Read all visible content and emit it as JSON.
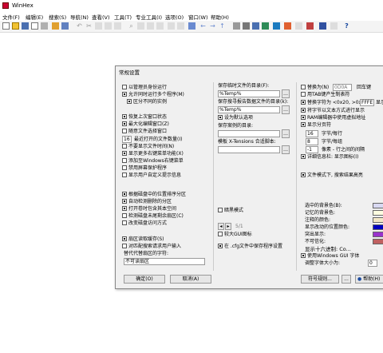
{
  "window": {
    "title": "WinHex"
  },
  "menu": [
    "文件(F)",
    "编辑(E)",
    "搜索(S)",
    "导航(N)",
    "查看(V)",
    "工具(T)",
    "专业工具(I)",
    "选项(O)",
    "窗口(W)",
    "帮助(H)"
  ],
  "dialog": {
    "title": "常规设置",
    "col1": {
      "run_as_admin": "以管理员身份运行",
      "allow_multi": "允许同时运行多个程序(M)",
      "no_sync": "区分不同的实例",
      "restore_last": "恢复上次窗口状态",
      "maximize": "最大化编辑窗口(Z)",
      "open_file_window": "随意文件选择窗口",
      "recent_count": "16",
      "recent_label": "最近打开的文件数量(I)",
      "no_show_time": "不要显示文件时间(N)",
      "more_right_menu": "显示更多右键菜单功能(X)",
      "add_windows_menu": "添加至Windows右键菜单",
      "disable_screensaver": "禁用屏幕保护程序",
      "show_user_notes": "显示用户自定义提示信息",
      "sort_by_partition": "根据磁盘中的位置排序分区",
      "auto_detect": "自动检测删除的分区",
      "open_in_place": "打开卷时包含其本空间",
      "check_size": "检测磁盘未尾剩余扇区(C)",
      "copy_access": "改变磁盘访问方式",
      "read_cache": "扇区读取缓存(S)",
      "ask_copy": "对匹配搜索请求用户输入",
      "user_string_label": "替代代替扇区的字符:",
      "user_string_value": "不可读扇区"
    },
    "col2": {
      "temp_folder_label": "保存临时文件的目录(F):",
      "temp_folder_value": "%Temp%",
      "project_folder_label": "保存搜寻报告数据文件的目录(k):",
      "project_folder_value": "%Temp%",
      "set_default": "设为默认选项",
      "save_folder_label": "保存案例的目录:",
      "save_folder_value": "",
      "xtensions_label": "模板 X-Tensions 合适脚本:",
      "xtensions_value": "",
      "dark_mode": "暗黑模式",
      "page_indicator": "5/1",
      "gui_icons": "较大GUI图标",
      "save_ini": "在 .cfg文件中保存程序设置"
    },
    "col3": {
      "replace_as": "替换为(N)",
      "replace_code": "0D0A",
      "replace_suffix": "回车键",
      "tab_generate": "用TAB键产生制表符",
      "replace_char_label": "替换字符为 <0x20, >0x",
      "replace_char_value": "FFFE",
      "replace_char_suffix": "显示",
      "show_text_mode": "将字节以文本方式进行显示",
      "ram_editor": "RAM编辑器中使用虚拟地址",
      "show_tab_label": "显示分页符",
      "bytes_per_line": "16",
      "bytes_per_line_label": "字节/每行",
      "group_count": "8",
      "group_label": "字节/每组",
      "indent": "-1",
      "indent_label": "像素 - 行之间的间隔",
      "detail_check": "详细信息栏: 显示图标(I)",
      "file_mode_label": "文件模式下, 搜索结果高亮",
      "bg_color_label": "选中的背景色(B):",
      "highlight_bg_label": "记忆的背景色:",
      "comment_bg_label": "注释的颜色:",
      "modified_bg_label": "显示改动的位置颜色:",
      "misc_bg_label": "突出显示:",
      "bad_label": "不可信化:",
      "hex_label": "显示十六进制: Co...",
      "windows_gui": "使用Windows GUI 字体",
      "font_size_label": "调整字体大小为:",
      "font_size_value": "0"
    },
    "colors": {
      "sel_bg": "#d9d9f2",
      "mem_bg": "#fdfde0",
      "comment": "#f3e7c6",
      "modified": "#0000c0",
      "highlight": "#9933cc",
      "bad": "#c06060"
    },
    "buttons": {
      "ok": "确定(O)",
      "cancel": "取消(A)",
      "codepage": "符号规则...",
      "more": "...",
      "help": "帮助(H)"
    }
  }
}
